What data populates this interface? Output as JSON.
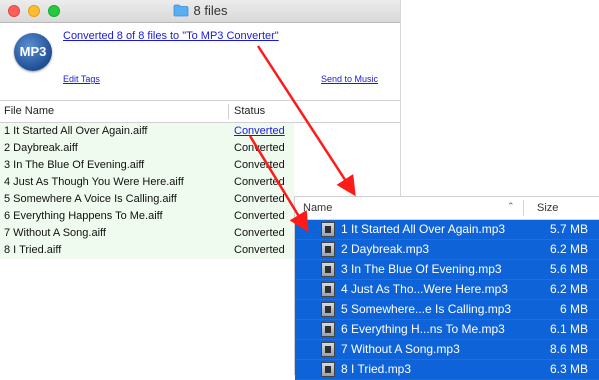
{
  "window": {
    "title": "8 files",
    "summary_link": "Converted 8 of 8 files to \"To MP3 Converter\"",
    "logo_text": "MP3",
    "edit_tags": "Edit Tags",
    "send_to_music": "Send to Music",
    "columns": {
      "file_name": "File Name",
      "status": "Status"
    },
    "rows": [
      {
        "name": "1 It Started All Over Again.aiff",
        "status": "Converted"
      },
      {
        "name": "2 Daybreak.aiff",
        "status": "Converted"
      },
      {
        "name": "3 In The Blue Of Evening.aiff",
        "status": "Converted"
      },
      {
        "name": "4 Just As Though You Were Here.aiff",
        "status": "Converted"
      },
      {
        "name": "5 Somewhere A Voice Is Calling.aiff",
        "status": "Converted"
      },
      {
        "name": "6 Everything Happens To Me.aiff",
        "status": "Converted"
      },
      {
        "name": "7 Without A Song.aiff",
        "status": "Converted"
      },
      {
        "name": "8 I Tried.aiff",
        "status": "Converted"
      }
    ]
  },
  "finder": {
    "columns": {
      "name": "Name",
      "size": "Size"
    },
    "rows": [
      {
        "name": "1 It Started All Over Again.mp3",
        "size": "5.7 MB"
      },
      {
        "name": "2 Daybreak.mp3",
        "size": "6.2 MB"
      },
      {
        "name": "3 In The Blue Of Evening.mp3",
        "size": "5.6 MB"
      },
      {
        "name": "4 Just As Tho...Were Here.mp3",
        "size": "6.2 MB"
      },
      {
        "name": "5 Somewhere...e Is Calling.mp3",
        "size": "6 MB"
      },
      {
        "name": "6 Everything H...ns To Me.mp3",
        "size": "6.1 MB"
      },
      {
        "name": "7 Without A Song.mp3",
        "size": "8.6 MB"
      },
      {
        "name": "8 I Tried.mp3",
        "size": "6.3 MB"
      }
    ]
  },
  "colors": {
    "selection": "#0f63d9",
    "link": "#1a1adb",
    "arrow": "#ff1a1a",
    "row_tint": "#f0fbef"
  }
}
